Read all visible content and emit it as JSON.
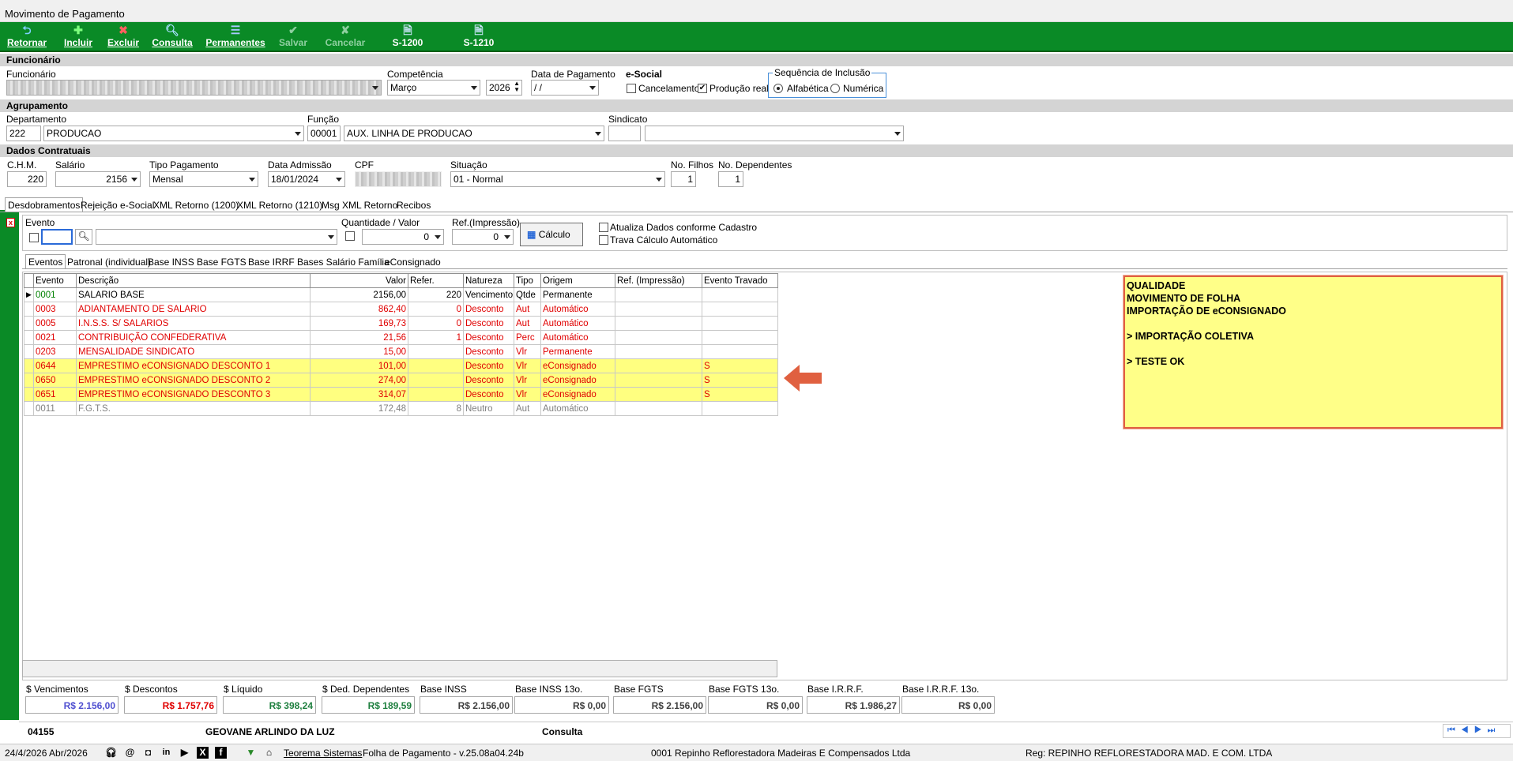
{
  "window": {
    "title": "Movimento de Pagamento"
  },
  "toolbar": {
    "retornar": "Retornar",
    "incluir": "Incluir",
    "excluir": "Excluir",
    "consulta": "Consulta",
    "permanentes": "Permanentes",
    "salvar": "Salvar",
    "cancelar": "Cancelar",
    "s1200": "S-1200",
    "s1210": "S-1210"
  },
  "funcionario": {
    "section": "Funcionário",
    "label": "Funcionário",
    "competencia_label": "Competência",
    "competencia_mes": "Março",
    "competencia_ano": "2026",
    "data_pagamento_label": "Data de Pagamento",
    "data_pagamento": " / /",
    "esocial_label": "e-Social",
    "cancelamento_label": "Cancelamento",
    "producao_label": "Produção real",
    "sequencia_label": "Sequência de Inclusão",
    "alfabetica_label": "Alfabética",
    "numerica_label": "Numérica"
  },
  "agrupamento": {
    "section": "Agrupamento",
    "departamento_label": "Departamento",
    "departamento_codigo": "222",
    "departamento_nome": "PRODUCAO",
    "funcao_label": "Função",
    "funcao_codigo": "00001",
    "funcao_nome": "AUX. LINHA DE PRODUCAO",
    "sindicato_label": "Sindicato"
  },
  "contratuais": {
    "section": "Dados Contratuais",
    "chm_label": "C.H.M.",
    "chm": "220",
    "salario_label": "Salário",
    "salario": "2156",
    "tipo_pag_label": "Tipo Pagamento",
    "tipo_pag": "Mensal",
    "admissao_label": "Data Admissão",
    "admissao": "18/01/2024",
    "cpf_label": "CPF",
    "situacao_label": "Situação",
    "situacao": "01 - Normal",
    "filhos_label": "No. Filhos",
    "filhos": "1",
    "dependentes_label": "No. Dependentes",
    "dependentes": "1"
  },
  "tabs": [
    "Desdobramentos",
    "Rejeição e-Social",
    "XML Retorno (1200)",
    "XML Retorno (1210)",
    "Msg XML Retorno",
    "Recibos"
  ],
  "evento_panel": {
    "evento_label": "Evento",
    "qtd_label": "Quantidade / Valor",
    "qtd_value": "0",
    "ref_label": "Ref.(Impressão)",
    "ref_value": "0",
    "calculo": "Cálculo",
    "atualiza": "Atualiza Dados conforme Cadastro",
    "trava": "Trava Cálculo Automático"
  },
  "subtabs": [
    "Eventos",
    "Patronal (individual)",
    "Base INSS",
    "Base FGTS",
    "Base IRRF",
    "Bases Salário Família",
    "eConsignado"
  ],
  "grid": {
    "headers": [
      "Evento",
      "Descrição",
      "Valor",
      "Refer.",
      "Natureza",
      "Tipo",
      "Origem",
      "Ref. (Impressão)",
      "Evento Travado"
    ],
    "rows": [
      {
        "evento": "0001",
        "descricao": "SALARIO BASE",
        "valor": "2156,00",
        "refer": "220",
        "natureza": "Vencimento",
        "tipo": "Qtde",
        "origem": "Permanente",
        "ref_imp": "",
        "travado": "",
        "style": "normal",
        "evento_color": "#008000"
      },
      {
        "evento": "0003",
        "descricao": "ADIANTAMENTO DE SALARIO",
        "valor": "862,40",
        "refer": "0",
        "natureza": "Desconto",
        "tipo": "Aut",
        "origem": "Automático",
        "ref_imp": "",
        "travado": "",
        "style": "red"
      },
      {
        "evento": "0005",
        "descricao": "I.N.S.S. S/ SALARIOS",
        "valor": "169,73",
        "refer": "0",
        "natureza": "Desconto",
        "tipo": "Aut",
        "origem": "Automático",
        "ref_imp": "",
        "travado": "",
        "style": "red"
      },
      {
        "evento": "0021",
        "descricao": "CONTRIBUIÇÃO CONFEDERATIVA",
        "valor": "21,56",
        "refer": "1",
        "natureza": "Desconto",
        "tipo": "Perc",
        "origem": "Automático",
        "ref_imp": "",
        "travado": "",
        "style": "red"
      },
      {
        "evento": "0203",
        "descricao": "MENSALIDADE SINDICATO",
        "valor": "15,00",
        "refer": "",
        "natureza": "Desconto",
        "tipo": "Vlr",
        "origem": "Permanente",
        "ref_imp": "",
        "travado": "",
        "style": "red"
      },
      {
        "evento": "0644",
        "descricao": "EMPRESTIMO eCONSIGNADO DESCONTO  1",
        "valor": "101,00",
        "refer": "",
        "natureza": "Desconto",
        "tipo": "Vlr",
        "origem": "eConsignado",
        "ref_imp": "",
        "travado": "S",
        "style": "yel"
      },
      {
        "evento": "0650",
        "descricao": "EMPRESTIMO eCONSIGNADO DESCONTO  2",
        "valor": "274,00",
        "refer": "",
        "natureza": "Desconto",
        "tipo": "Vlr",
        "origem": "eConsignado",
        "ref_imp": "",
        "travado": "S",
        "style": "yel"
      },
      {
        "evento": "0651",
        "descricao": "EMPRESTIMO eCONSIGNADO DESCONTO  3",
        "valor": "314,07",
        "refer": "",
        "natureza": "Desconto",
        "tipo": "Vlr",
        "origem": "eConsignado",
        "ref_imp": "",
        "travado": "S",
        "style": "yel"
      },
      {
        "evento": "0011",
        "descricao": "F.G.T.S.",
        "valor": "172,48",
        "refer": "8",
        "natureza": "Neutro",
        "tipo": "Aut",
        "origem": "Automático",
        "ref_imp": "",
        "travado": "",
        "style": "gray"
      }
    ]
  },
  "note": {
    "lines": [
      "QUALIDADE",
      "MOVIMENTO DE FOLHA",
      "IMPORTAÇÃO DE eCONSIGNADO",
      "",
      "> IMPORTAÇÃO COLETIVA",
      "",
      "> TESTE OK"
    ]
  },
  "totals": {
    "vencimentos_label": "$ Vencimentos",
    "vencimentos": "R$ 2.156,00",
    "descontos_label": "$ Descontos",
    "descontos": "R$ 1.757,76",
    "liquido_label": "$ Líquido",
    "liquido": "R$ 398,24",
    "ded_label": "$ Ded. Dependentes",
    "ded": "R$ 189,59",
    "inss_label": "Base INSS",
    "inss": "R$ 2.156,00",
    "inss13_label": "Base INSS 13o.",
    "inss13": "R$ 0,00",
    "fgts_label": "Base FGTS",
    "fgts": "R$ 2.156,00",
    "fgts13_label": "Base FGTS 13o.",
    "fgts13": "R$ 0,00",
    "irrf_label": "Base I.R.R.F.",
    "irrf": "R$ 1.986,27",
    "irrf13_label": "Base I.R.R.F. 13o.",
    "irrf13": "R$ 0,00"
  },
  "record_bar": {
    "codigo": "04155",
    "nome": "GEOVANE ARLINDO DA LUZ",
    "modo": "Consulta"
  },
  "status": {
    "data": "24/4/2026 Abr/2026",
    "empresa_link": "Teorema Sistemas",
    "versao": "Folha de Pagamento - v.25.08a04.24b",
    "empresa": "0001 Repinho Reflorestadora Madeiras E Compensados Ltda",
    "reg": "Reg: REPINHO REFLORESTADORA MAD. E COM. LTDA"
  },
  "colors": {
    "toolbar": "#0a8a26",
    "red_text": "#e00000",
    "highlight": "#ffff80",
    "note_bg": "#ffff88",
    "arrow": "#e06040"
  }
}
